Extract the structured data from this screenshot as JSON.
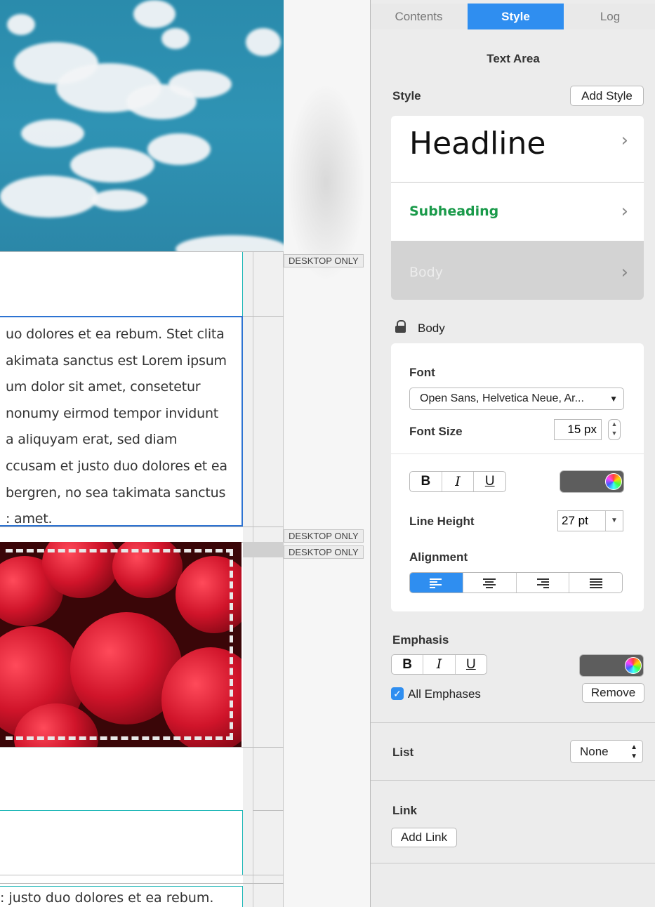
{
  "canvas": {
    "tag_label": "DESKTOP ONLY",
    "body_lines": [
      "uo dolores et ea rebum. Stet clita",
      "akimata sanctus est Lorem ipsum",
      "um dolor sit amet, consetetur",
      " nonumy eirmod tempor invidunt",
      "a aliquyam erat, sed diam",
      "ccusam et justo duo dolores et ea",
      "bergren, no sea takimata sanctus",
      ": amet."
    ],
    "bottom_line": ": justo duo dolores et ea rebum."
  },
  "panel": {
    "tabs": [
      "Contents",
      "Style",
      "Log"
    ],
    "active_tab": "Style",
    "section_title": "Text Area",
    "style_label": "Style",
    "add_style_label": "Add Style",
    "styles": [
      {
        "label": "Headline"
      },
      {
        "label": "Subheading",
        "color": "#1a9a4a"
      },
      {
        "label": "Body"
      }
    ],
    "body_section": {
      "lock_label": "Body",
      "font_label": "Font",
      "font_value": "Open Sans, Helvetica Neue, Ar...",
      "font_size_label": "Font Size",
      "font_size_value": "15 px",
      "bold": "B",
      "italic": "I",
      "underline": "U",
      "line_height_label": "Line Height",
      "line_height_value": "27 pt",
      "alignment_label": "Alignment",
      "alignment_selected": "left",
      "accent_color": "#2f8ef0"
    },
    "emphasis": {
      "label": "Emphasis",
      "bold": "B",
      "italic": "I",
      "underline": "U",
      "all_emphases_label": "All Emphases",
      "all_emphases_checked": true,
      "remove_label": "Remove"
    },
    "list": {
      "label": "List",
      "value": "None"
    },
    "link": {
      "label": "Link",
      "add_label": "Add Link"
    }
  }
}
